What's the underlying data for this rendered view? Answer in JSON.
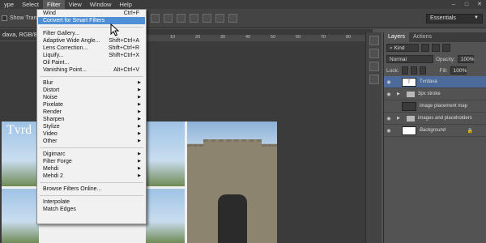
{
  "menubar": {
    "items": [
      {
        "label": "ype"
      },
      {
        "label": "Select"
      },
      {
        "label": "Filter"
      },
      {
        "label": "View"
      },
      {
        "label": "Window"
      },
      {
        "label": "Help"
      }
    ],
    "window_controls": [
      "–",
      "□",
      "✕"
    ]
  },
  "options_bar": {
    "show_transform_label": "Show Trans",
    "workspace": "Essentials"
  },
  "document": {
    "tab_title": "dava, RGB/8)",
    "ruler_marks": [
      "10",
      "20",
      "30",
      "40",
      "50",
      "60",
      "70",
      "80"
    ],
    "preview_title": "Tvrd"
  },
  "filter_menu": {
    "items": [
      {
        "label": "Wind",
        "shortcut": "Ctrl+F"
      },
      {
        "label": "Convert for Smart Filters",
        "highlighted": true
      },
      {
        "sep": true
      },
      {
        "label": "Filter Gallery..."
      },
      {
        "label": "Adaptive Wide Angle...",
        "shortcut": "Shift+Ctrl+A"
      },
      {
        "label": "Lens Correction...",
        "shortcut": "Shift+Ctrl+R"
      },
      {
        "label": "Liquify...",
        "shortcut": "Shift+Ctrl+X"
      },
      {
        "label": "Oil Paint..."
      },
      {
        "label": "Vanishing Point...",
        "shortcut": "Alt+Ctrl+V"
      },
      {
        "sep": true
      },
      {
        "label": "Blur",
        "submenu": true
      },
      {
        "label": "Distort",
        "submenu": true
      },
      {
        "label": "Noise",
        "submenu": true
      },
      {
        "label": "Pixelate",
        "submenu": true
      },
      {
        "label": "Render",
        "submenu": true
      },
      {
        "label": "Sharpen",
        "submenu": true
      },
      {
        "label": "Stylize",
        "submenu": true
      },
      {
        "label": "Video",
        "submenu": true
      },
      {
        "label": "Other",
        "submenu": true
      },
      {
        "sep": true
      },
      {
        "label": "Digimarc",
        "submenu": true
      },
      {
        "label": "Filter Forge",
        "submenu": true
      },
      {
        "label": "Mehdi",
        "submenu": true
      },
      {
        "label": "Mehdi 2",
        "submenu": true
      },
      {
        "sep": true
      },
      {
        "label": "Browse Filters Online..."
      },
      {
        "sep": true
      },
      {
        "label": "Interpolate"
      },
      {
        "label": "Match Edges"
      }
    ]
  },
  "layers_panel": {
    "tabs": [
      "Layers",
      "Actions"
    ],
    "kind_label": "Kind",
    "blend_mode": "Normal",
    "opacity_label": "Opacity:",
    "opacity_value": "100%",
    "lock_label": "Lock:",
    "fill_label": "Fill:",
    "fill_value": "100%",
    "layers": [
      {
        "name": "Tvrdava",
        "type": "text",
        "selected": true,
        "thumb": "T"
      },
      {
        "name": "3px stroke",
        "type": "group"
      },
      {
        "name": "image placement map",
        "type": "layer"
      },
      {
        "name": "images and placeholders",
        "type": "group"
      },
      {
        "name": "Background",
        "type": "background"
      }
    ]
  },
  "colors": {
    "menu_highlight": "#4e8fd6",
    "layer_selected": "#4c6b9a",
    "app_dark": "#3c3c3c",
    "panel_bg": "#535353"
  }
}
